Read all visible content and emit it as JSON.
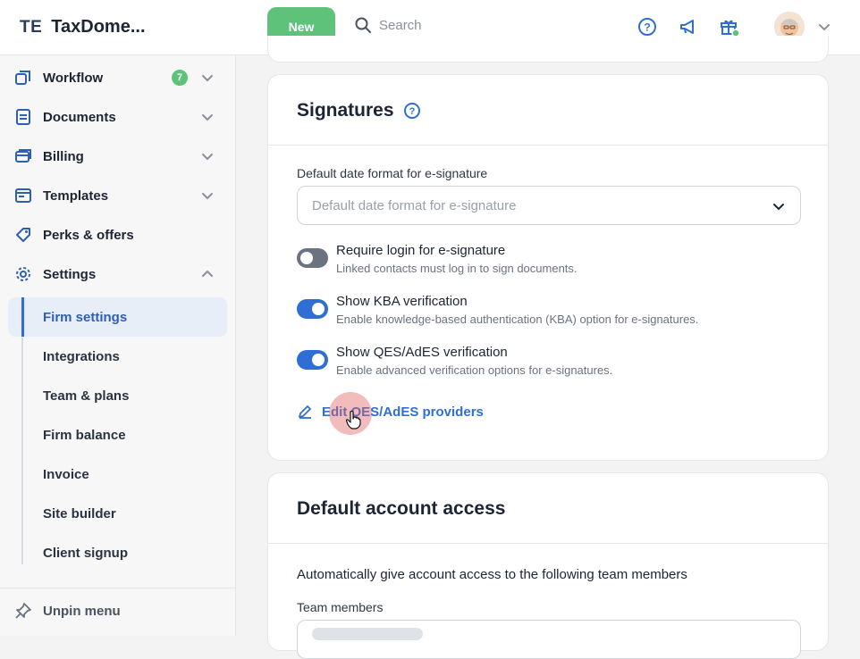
{
  "header": {
    "logo_mark": "TE",
    "app_name": "TaxDome...",
    "new_label": "New",
    "search_placeholder": "Search"
  },
  "sidebar": {
    "items": [
      {
        "label": "Workflow",
        "badge": "7"
      },
      {
        "label": "Documents"
      },
      {
        "label": "Billing"
      },
      {
        "label": "Templates"
      },
      {
        "label": "Perks & offers"
      },
      {
        "label": "Settings"
      }
    ],
    "settings_sub": [
      "Firm settings",
      "Integrations",
      "Team & plans",
      "Firm balance",
      "Invoice",
      "Site builder",
      "Client signup"
    ],
    "unpin_label": "Unpin menu"
  },
  "signatures": {
    "title": "Signatures",
    "date_format_label": "Default date format for e-signature",
    "date_format_placeholder": "Default date format for e-signature",
    "toggles": [
      {
        "title": "Require login for e-signature",
        "desc": "Linked contacts must log in to sign documents.",
        "on": false
      },
      {
        "title": "Show KBA verification",
        "desc": "Enable knowledge-based authentication (KBA) option for e-signatures.",
        "on": true
      },
      {
        "title": "Show QES/AdES verification",
        "desc": "Enable advanced verification options for e-signatures.",
        "on": true
      }
    ],
    "edit_link": "Edit QES/AdES providers"
  },
  "account_access": {
    "title": "Default account access",
    "description": "Automatically give account access to the following team members",
    "team_members_label": "Team members"
  },
  "colors": {
    "accent": "#2f6fd4",
    "new_button": "#5fc27a",
    "toggle_off": "#6b7280"
  }
}
